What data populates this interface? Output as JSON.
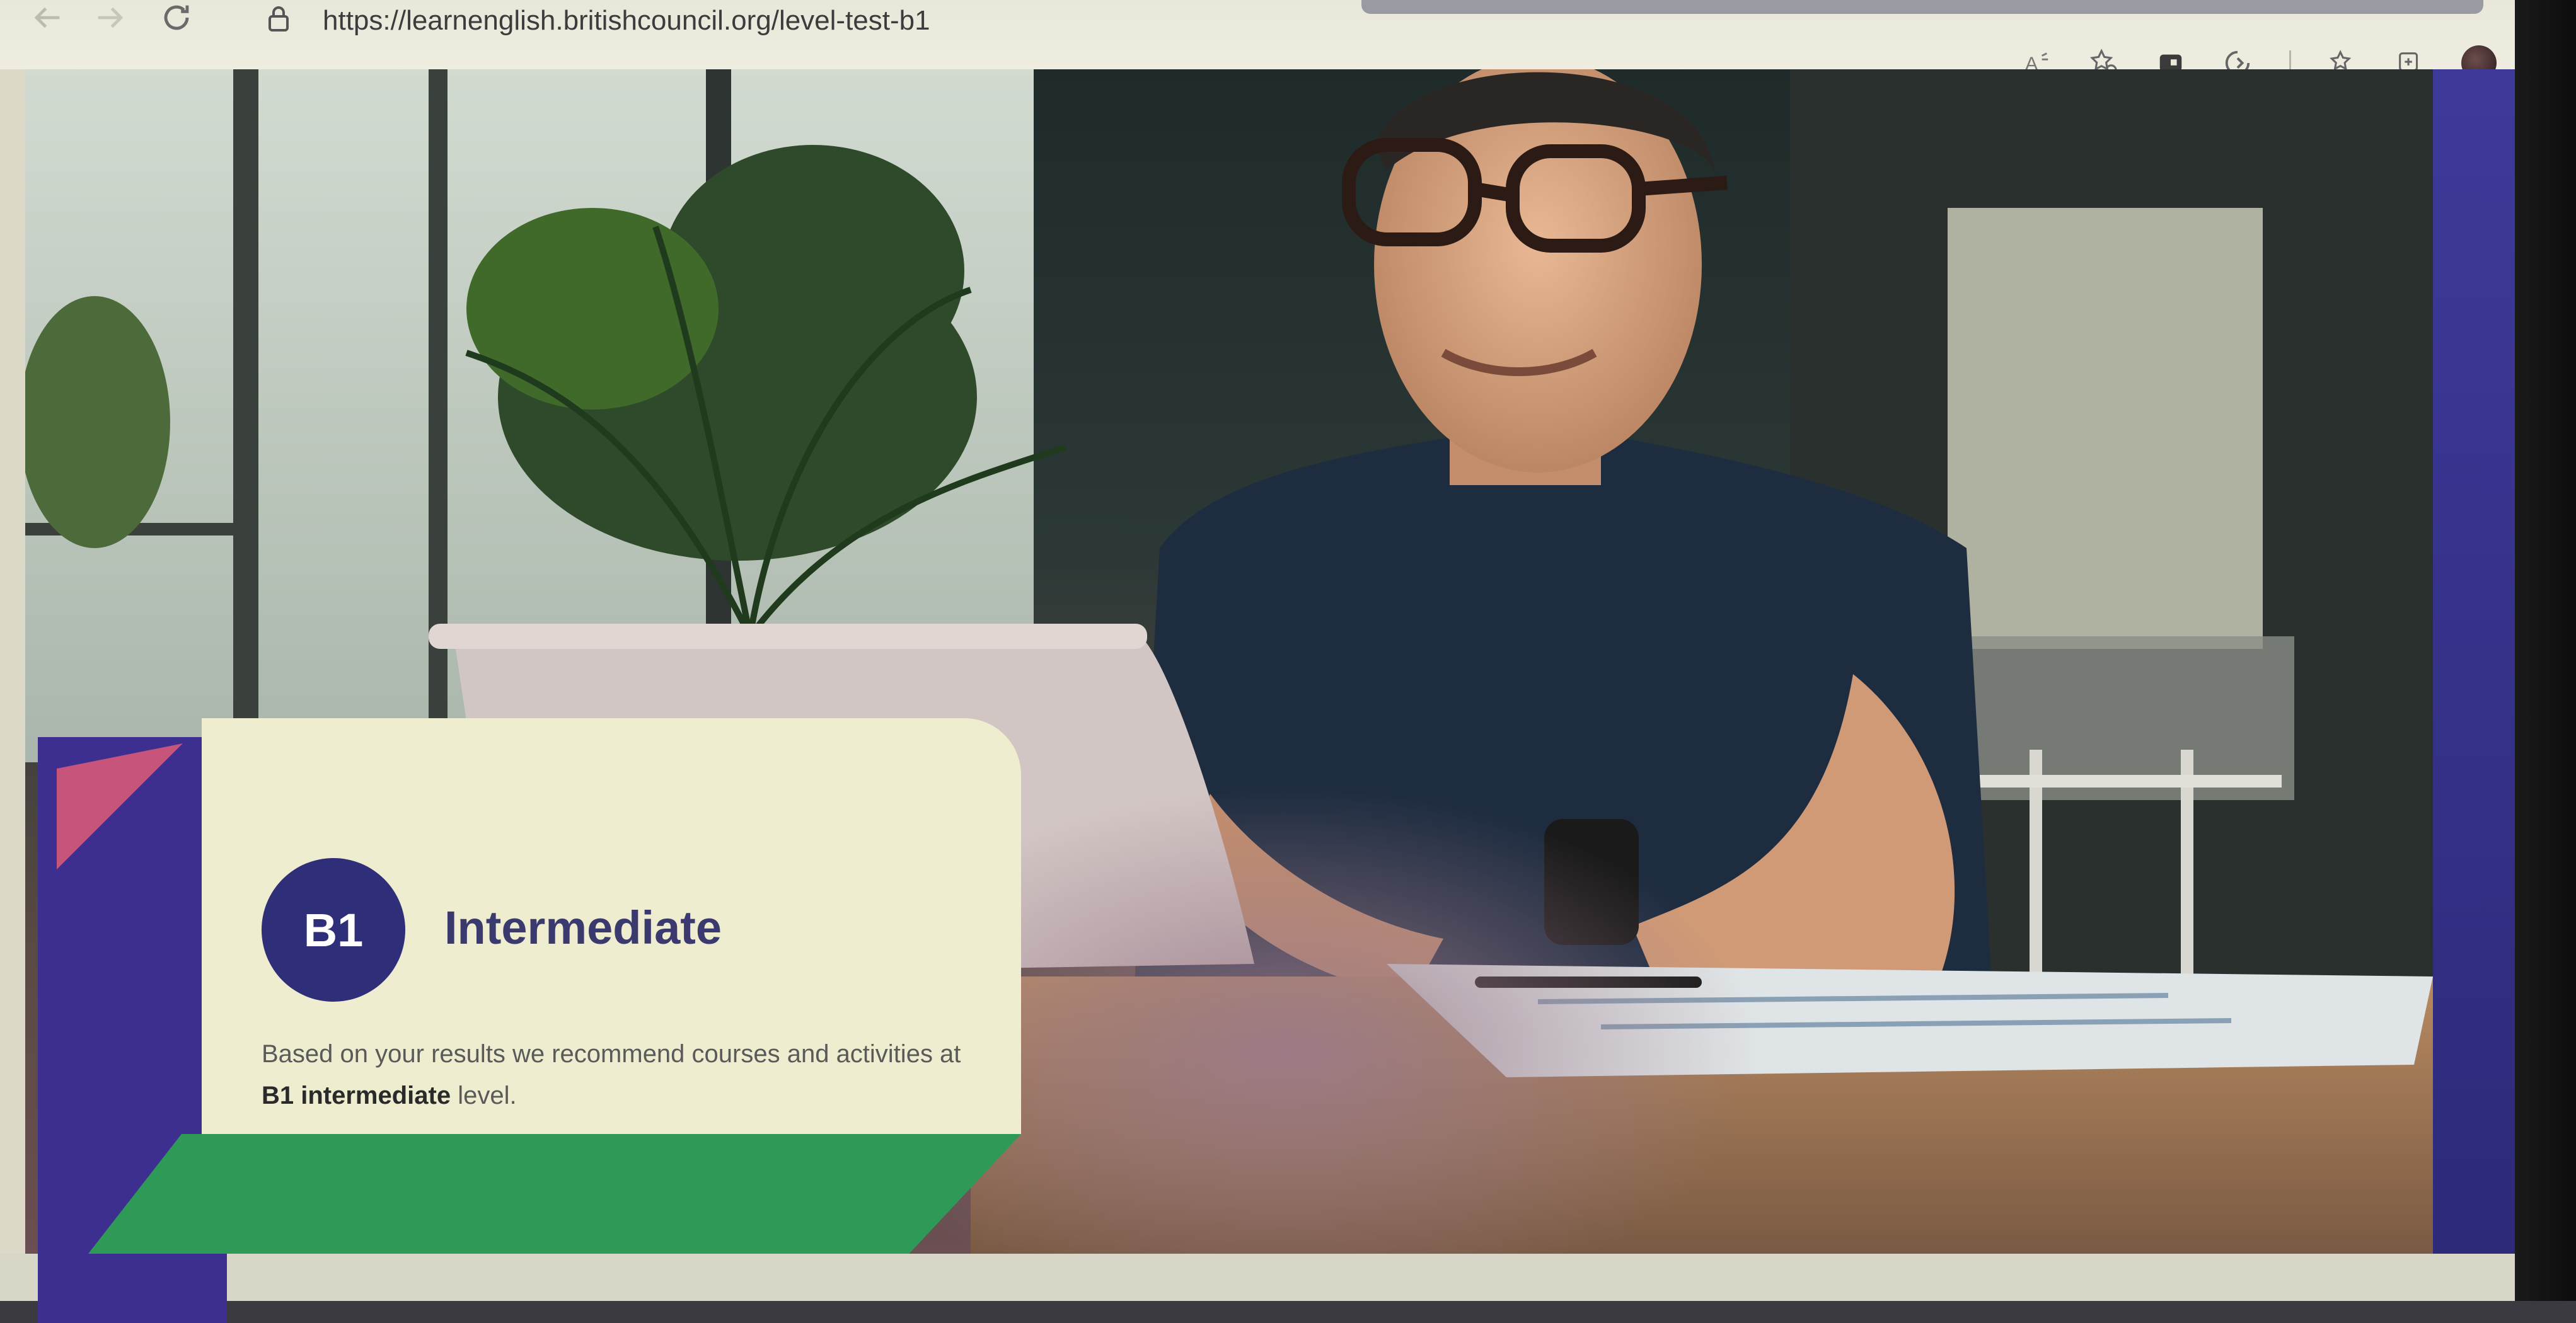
{
  "browser": {
    "url": "https://learnenglish.britishcouncil.org/level-test-b1",
    "toolbar_icons": [
      "read-aloud-icon",
      "favorite-add-icon",
      "extension-icon",
      "copilot-icon",
      "favorites-icon",
      "collections-icon",
      "profile-avatar",
      "more-icon"
    ]
  },
  "result": {
    "badge": "B1",
    "title": "Intermediate",
    "description_prefix": "Based on your results we recommend courses and activities at ",
    "description_bold": "B1 intermediate",
    "description_suffix": " level."
  },
  "colors": {
    "badge_bg": "#2f2e78",
    "title": "#3a3a6e",
    "card_bg": "#efedcf",
    "accent_purple": "#3d2f8f",
    "accent_green": "#2f9a58",
    "accent_pink": "#c7547a"
  }
}
